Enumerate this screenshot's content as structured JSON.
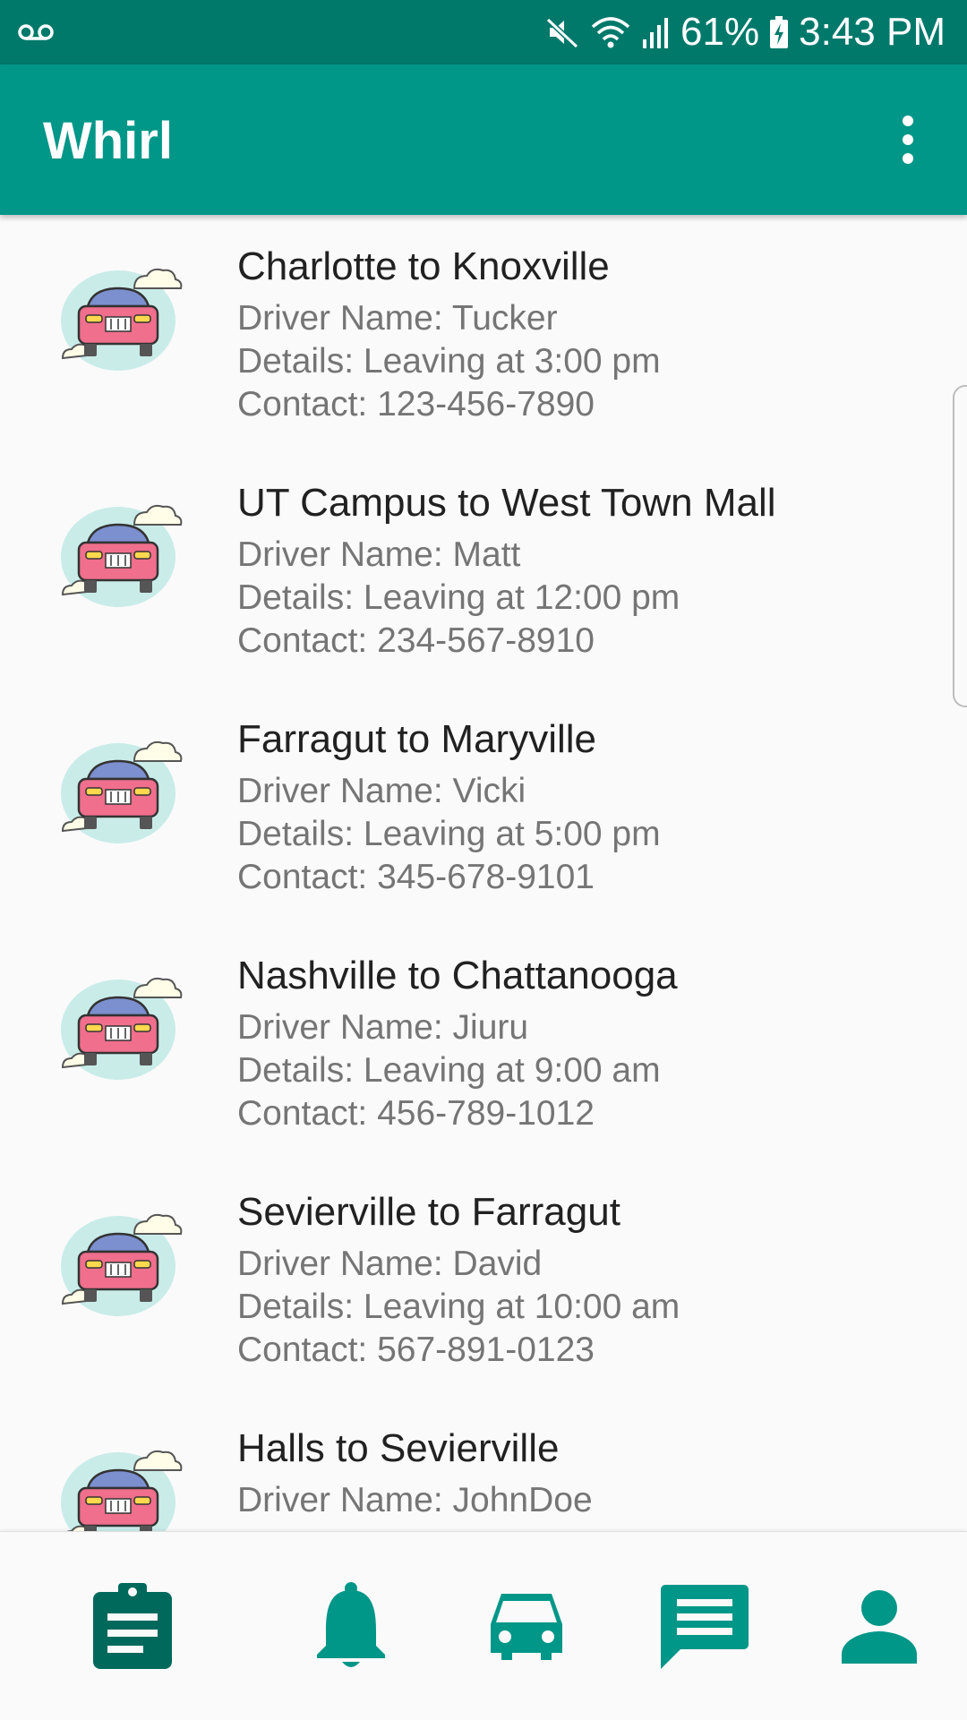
{
  "status_bar": {
    "battery": "61%",
    "time": "3:43 PM",
    "icons": [
      "voicemail-icon",
      "mute-icon",
      "wifi-icon",
      "signal-icon",
      "battery-charging-icon"
    ]
  },
  "app_bar": {
    "title": "Whirl",
    "menu_icon": "more-vert-icon"
  },
  "rides": [
    {
      "title": "Charlotte to Knoxville",
      "driver": "Driver Name: Tucker",
      "details": "Details: Leaving at 3:00 pm",
      "contact": "Contact: 123-456-7890"
    },
    {
      "title": "UT Campus to West Town Mall",
      "driver": "Driver Name: Matt",
      "details": "Details: Leaving at 12:00 pm",
      "contact": "Contact: 234-567-8910"
    },
    {
      "title": "Farragut to Maryville",
      "driver": "Driver Name: Vicki",
      "details": "Details: Leaving at 5:00 pm",
      "contact": "Contact: 345-678-9101"
    },
    {
      "title": "Nashville to Chattanooga",
      "driver": "Driver Name: Jiuru",
      "details": "Details: Leaving at 9:00 am",
      "contact": "Contact: 456-789-1012"
    },
    {
      "title": "Sevierville to Farragut",
      "driver": "Driver Name: David",
      "details": "Details: Leaving at 10:00 am",
      "contact": "Contact: 567-891-0123"
    },
    {
      "title": "Halls to Sevierville",
      "driver": "Driver Name: JohnDoe",
      "details": "",
      "contact": ""
    }
  ],
  "bottom_nav": {
    "items": [
      {
        "icon": "clipboard-icon",
        "selected": true
      },
      {
        "icon": "bell-icon",
        "selected": false
      },
      {
        "icon": "car-icon",
        "selected": false
      },
      {
        "icon": "message-icon",
        "selected": false
      },
      {
        "icon": "person-icon",
        "selected": false
      }
    ]
  },
  "colors": {
    "status_bar": "#00796b",
    "app_bar": "#009688",
    "nav_selected": "#00695c",
    "nav_default": "#009688",
    "title_text": "#212121",
    "secondary_text": "#757575"
  }
}
